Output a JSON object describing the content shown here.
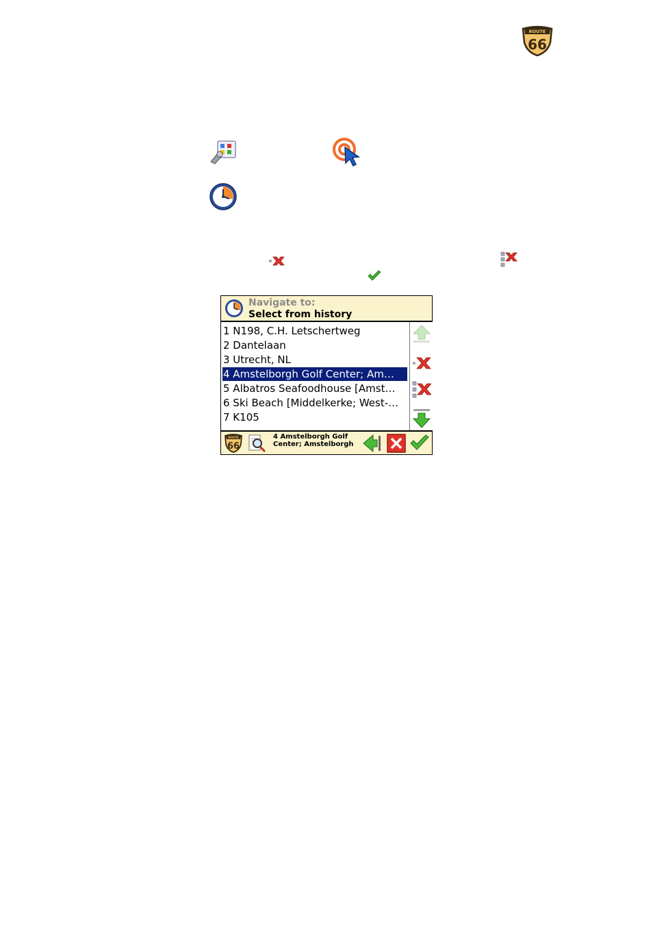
{
  "logo": {
    "top_text": "ROUTE",
    "number": "66"
  },
  "page_icons": [
    {
      "name": "settings-palette-icon"
    },
    {
      "name": "target-cursor-icon"
    },
    {
      "name": "history-clock-icon"
    },
    {
      "name": "delete-item-icon"
    },
    {
      "name": "delete-all-icon"
    },
    {
      "name": "confirm-check-icon"
    }
  ],
  "screen": {
    "header": {
      "line1": "Navigate to:",
      "line2": "Select from history"
    },
    "items": [
      {
        "label": "1 N198, C.H. Letschertweg",
        "selected": false
      },
      {
        "label": "2 Dantelaan",
        "selected": false
      },
      {
        "label": "3 Utrecht, NL",
        "selected": false
      },
      {
        "label": "4 Amstelborgh Golf Center; Am…",
        "selected": true
      },
      {
        "label": "5 Albatros Seafoodhouse [Amst…",
        "selected": false
      },
      {
        "label": "6 Ski Beach [Middelkerke; West-…",
        "selected": false
      },
      {
        "label": "7 K105",
        "selected": false
      }
    ],
    "footer": {
      "logo_number": "66",
      "logo_top": "ROUTE",
      "info_text": "4 Amstelborgh Golf Center; Amstelborgh"
    }
  },
  "colors": {
    "header_bg": "#fbf3cc",
    "selection_bg": "#0a1f7a",
    "accent_green": "#3fae2a",
    "accent_red": "#e0322a"
  }
}
